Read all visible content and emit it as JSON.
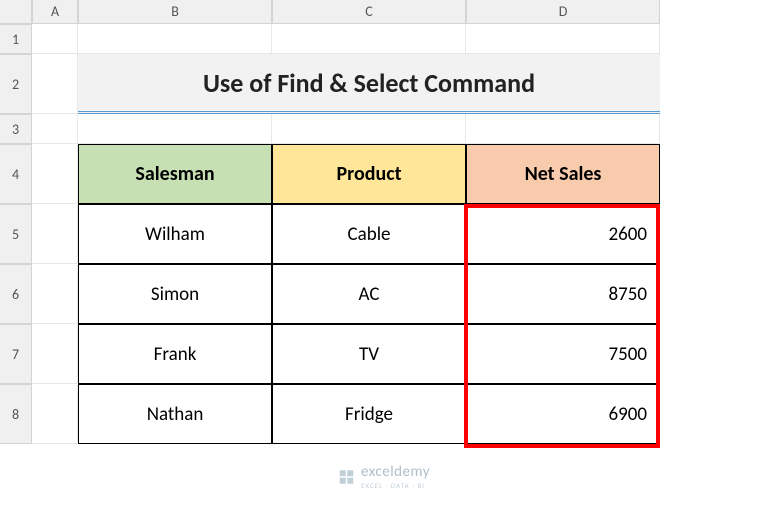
{
  "columns": [
    "A",
    "B",
    "C",
    "D"
  ],
  "rows": [
    "1",
    "2",
    "3",
    "4",
    "5",
    "6",
    "7",
    "8"
  ],
  "title": "Use of Find & Select Command",
  "headers": {
    "b": "Salesman",
    "c": "Product",
    "d": "Net Sales"
  },
  "data": [
    {
      "salesman": "Wilham",
      "product": "Cable",
      "net_sales": "2600"
    },
    {
      "salesman": "Simon",
      "product": "AC",
      "net_sales": "8750"
    },
    {
      "salesman": "Frank",
      "product": "TV",
      "net_sales": "7500"
    },
    {
      "salesman": "Nathan",
      "product": "Fridge",
      "net_sales": "6900"
    }
  ],
  "watermark": {
    "main": "exceldemy",
    "sub": "EXCEL · DATA · BI"
  },
  "chart_data": {
    "type": "table",
    "title": "Use of Find & Select Command",
    "columns": [
      "Salesman",
      "Product",
      "Net Sales"
    ],
    "rows": [
      [
        "Wilham",
        "Cable",
        2600
      ],
      [
        "Simon",
        "AC",
        8750
      ],
      [
        "Frank",
        "TV",
        7500
      ],
      [
        "Nathan",
        "Fridge",
        6900
      ]
    ]
  }
}
